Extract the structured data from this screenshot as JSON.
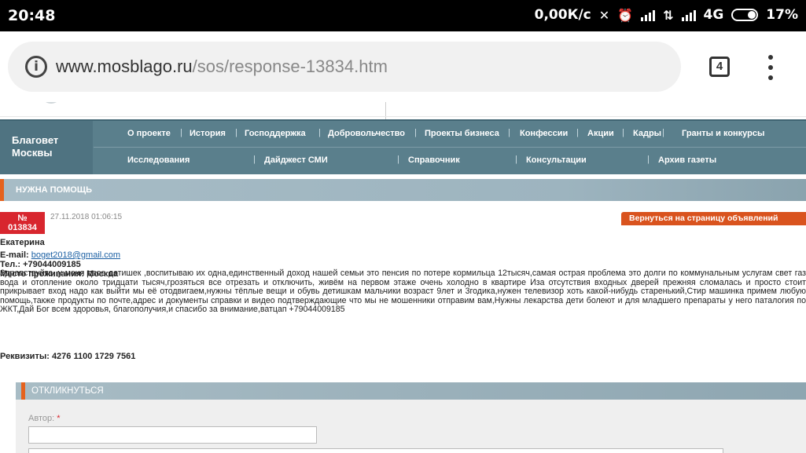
{
  "status_bar": {
    "time": "20:48",
    "speed": "0,00К/с",
    "network": "4G",
    "battery": "17%"
  },
  "browser": {
    "url_domain": "www.mosblago.ru",
    "url_path": "/sos/response-13834.htm",
    "tabs_count": "4"
  },
  "site": {
    "brand_line1": "Благовет",
    "brand_line2": "Москвы",
    "nav_row1": [
      "О проекте",
      "История",
      "Господдержка",
      "Добровольчество",
      "Проекты бизнеса",
      "Конфессии",
      "Акции",
      "Кадры",
      "Гранты и конкурсы"
    ],
    "nav_row2": [
      "Исследования",
      "Дайджест СМИ",
      "Справочник",
      "Консультации",
      "Архив газеты"
    ],
    "separator": "|"
  },
  "section": {
    "title": "НУЖНА ПОМОЩЬ"
  },
  "post": {
    "number_label": "№",
    "number": "013834",
    "date": "27.11.2018 01:06:15",
    "back_label": "Вернуться на страницу объявлений",
    "name": "Екатерина",
    "email_label": "E-mail:",
    "email": "boget2018@gmail.com",
    "phone_label": "Тел.:",
    "phone": "+79044009185",
    "residence_label": "Место проживания:",
    "residence": "Москва",
    "text": "Здравствуйте, у меня двое детишек ,воспитываю их одна,единственный доход нашей семьи это пенсия по потере кормильца 12тысяч,самая острая проблема это долги по коммунальным услугам свет газ вода и отопление около тридцати тысяч,грозяться все отрезать и отключить, живём на первом этаже очень холодно в квартире Иза отсутствия входных дверей прежняя сломалась и просто стоит прикрывает вход надо как выйти мы её отодвигаем,нужны тёплые вещи и обувь детишкам мальчики возраст 9лет и 3годика,нужен телевизор хоть какой-нибудь старенький,Стир машинка примем любую помощь,также продукты по почте,адрес и документы справки и видео подтверждающие что мы не мошенники отправим вам,Нужны лекарства дети болеют и для младшего препараты у него паталогия по ЖКТ,Дай Бог всем здоровья, благополучия,и спасибо за внимание,ватцап +79044009185",
    "requisites": "Реквизиты: 4276 1100 1729 7561"
  },
  "form": {
    "title": "ОТКЛИКНУТЬСЯ",
    "author_label": "Автор:",
    "required_mark": "*"
  },
  "colors": {
    "nav_bg": "#5a7f8c",
    "accent_orange": "#e5621d",
    "badge_red": "#d8262e"
  }
}
